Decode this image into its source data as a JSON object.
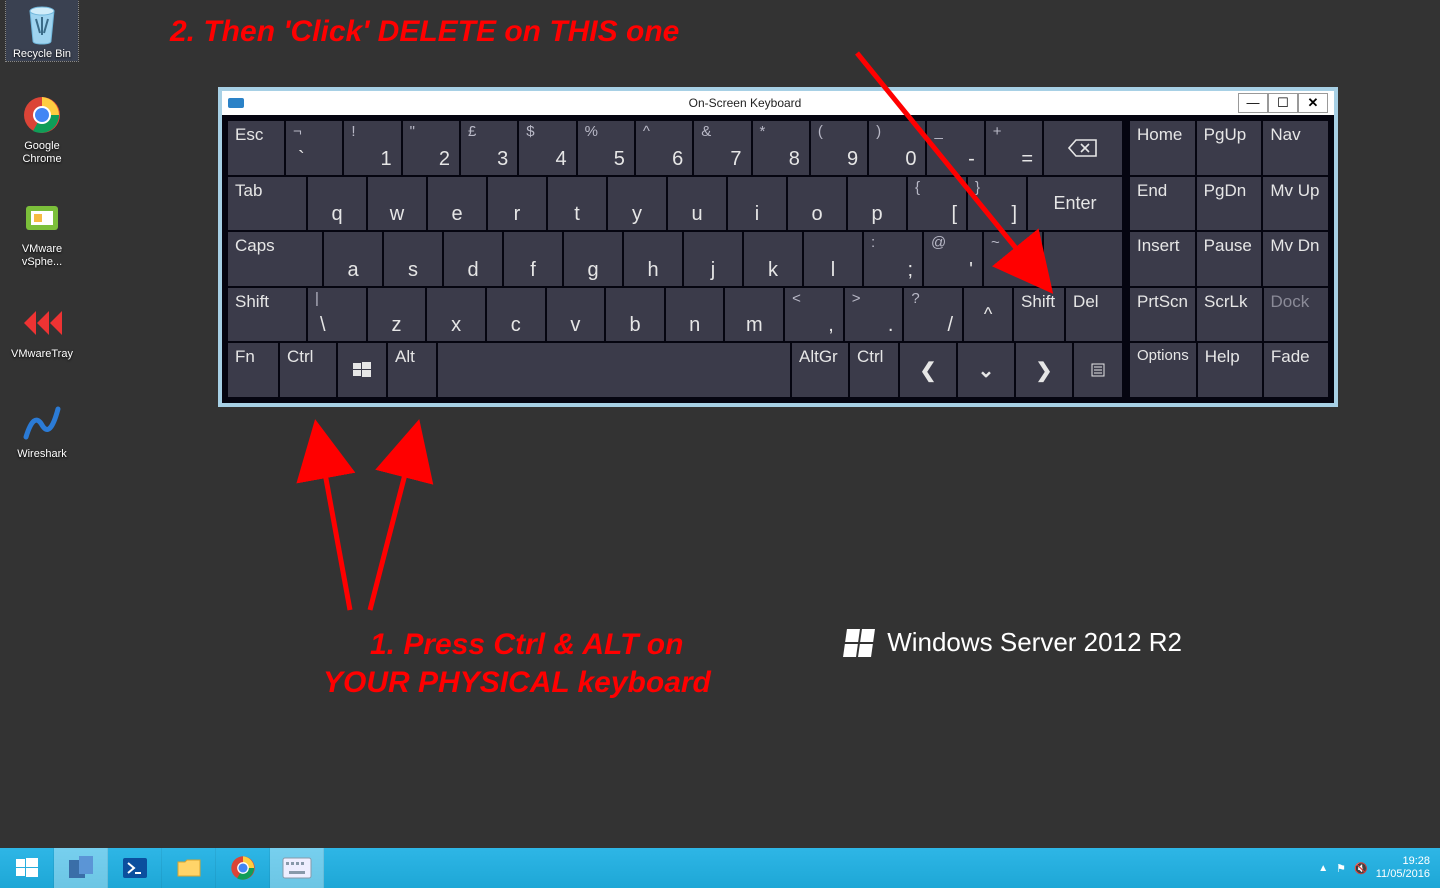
{
  "desktop_icons": [
    {
      "label": "Recycle Bin",
      "selected": true
    },
    {
      "label": "Google Chrome"
    },
    {
      "label": "VMware vSphe..."
    },
    {
      "label": "VMwareTray"
    },
    {
      "label": "Wireshark"
    }
  ],
  "annotations": {
    "step2": "2. Then 'Click' DELETE on THIS one",
    "step1a": "1. Press Ctrl & ALT on",
    "step1b": "YOUR PHYSICAL keyboard"
  },
  "osk": {
    "title": "On-Screen Keyboard",
    "rows": {
      "r1": [
        "Esc",
        "¬ `",
        "! 1",
        "\" 2",
        "£ 3",
        "$ 4",
        "% 5",
        "^ 6",
        "& 7",
        "* 8",
        "( 9",
        ") 0",
        "_ -",
        "+ ="
      ],
      "r2": [
        "Tab",
        "q",
        "w",
        "e",
        "r",
        "t",
        "y",
        "u",
        "i",
        "o",
        "p",
        "{ [",
        "} ]",
        "Enter"
      ],
      "r3": [
        "Caps",
        "a",
        "s",
        "d",
        "f",
        "g",
        "h",
        "j",
        "k",
        "l",
        ": ;",
        "@ '",
        "~ #"
      ],
      "r4": [
        "Shift",
        "| \\",
        "z",
        "x",
        "c",
        "v",
        "b",
        "n",
        "m",
        "< ,",
        "> .",
        "? /",
        "^",
        "Shift",
        "Del"
      ],
      "r5": [
        "Fn",
        "Ctrl",
        "",
        "Alt",
        "",
        "AltGr",
        "Ctrl",
        "",
        "",
        "",
        ""
      ]
    },
    "side": [
      [
        "Home",
        "PgUp",
        "Nav"
      ],
      [
        "End",
        "PgDn",
        "Mv Up"
      ],
      [
        "Insert",
        "Pause",
        "Mv Dn"
      ],
      [
        "PrtScn",
        "ScrLk",
        "Dock"
      ],
      [
        "Options",
        "Help",
        "Fade"
      ]
    ]
  },
  "watermark": "Windows Server 2012 R2",
  "taskbar": {
    "time": "19:28",
    "date": "11/05/2016"
  }
}
